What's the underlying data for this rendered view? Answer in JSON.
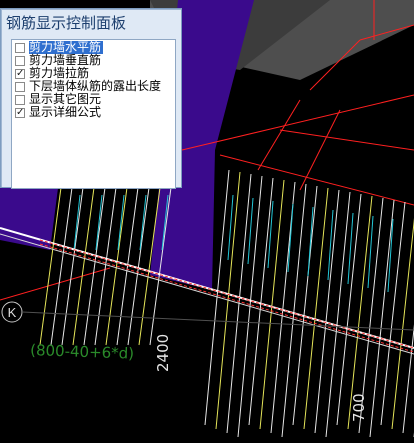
{
  "control_panel": {
    "title": "钢筋显示控制面板",
    "options": [
      {
        "label": "剪力墙水平筋",
        "checked": false,
        "selected": true
      },
      {
        "label": "剪力墙垂直筋",
        "checked": false,
        "selected": false
      },
      {
        "label": "剪力墙拉筋",
        "checked": true,
        "selected": false
      },
      {
        "label": "下层墙体纵筋的露出长度",
        "checked": false,
        "selected": false
      },
      {
        "label": "显示其它图元",
        "checked": false,
        "selected": false
      },
      {
        "label": "显示详细公式",
        "checked": true,
        "selected": false
      }
    ]
  },
  "drawing": {
    "axis_label": "K",
    "formula_annotation": "(800-40+6*d)",
    "dimension_2400": "2400",
    "dimension_700": "700",
    "colors": {
      "background": "#000000",
      "wall_fill": "#3a0a8c",
      "top_gray": "#505050",
      "grid_red": "#ff2020",
      "rebar_white": "#e8e8e8",
      "rebar_yellow": "#e6e65a",
      "rebar_cyan": "#24c8d8",
      "formula_green": "#2a8a2a"
    }
  }
}
